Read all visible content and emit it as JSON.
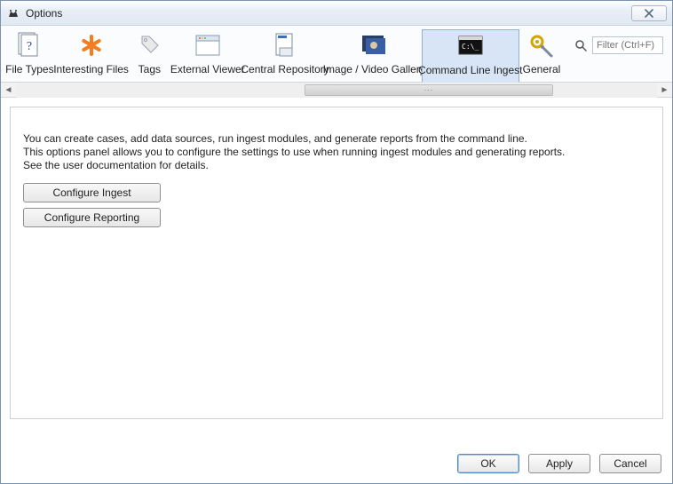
{
  "window": {
    "title": "Options"
  },
  "filter": {
    "placeholder": "Filter (Ctrl+F)"
  },
  "tabs": [
    {
      "label": "File Types",
      "icon": "file-question-icon"
    },
    {
      "label": "Interesting Files",
      "icon": "asterisk-icon"
    },
    {
      "label": "Tags",
      "icon": "tag-icon"
    },
    {
      "label": "External Viewer",
      "icon": "window-icon"
    },
    {
      "label": "Central Repository",
      "icon": "file-box-icon"
    },
    {
      "label": "Image / Video Gallery",
      "icon": "photo-icon"
    },
    {
      "label": "Command Line Ingest",
      "icon": "terminal-icon"
    },
    {
      "label": "General",
      "icon": "gear-wrench-icon"
    }
  ],
  "selected_tab_index": 6,
  "panel": {
    "line1": "You can create cases, add data sources, run ingest modules, and generate reports from the command line.",
    "line2": "This options panel allows you to configure the settings to use when running ingest modules and generating reports.",
    "line3": "See the user documentation for details.",
    "btn_configure_ingest": "Configure Ingest",
    "btn_configure_reporting": "Configure Reporting"
  },
  "footer": {
    "ok": "OK",
    "apply": "Apply",
    "cancel": "Cancel"
  }
}
